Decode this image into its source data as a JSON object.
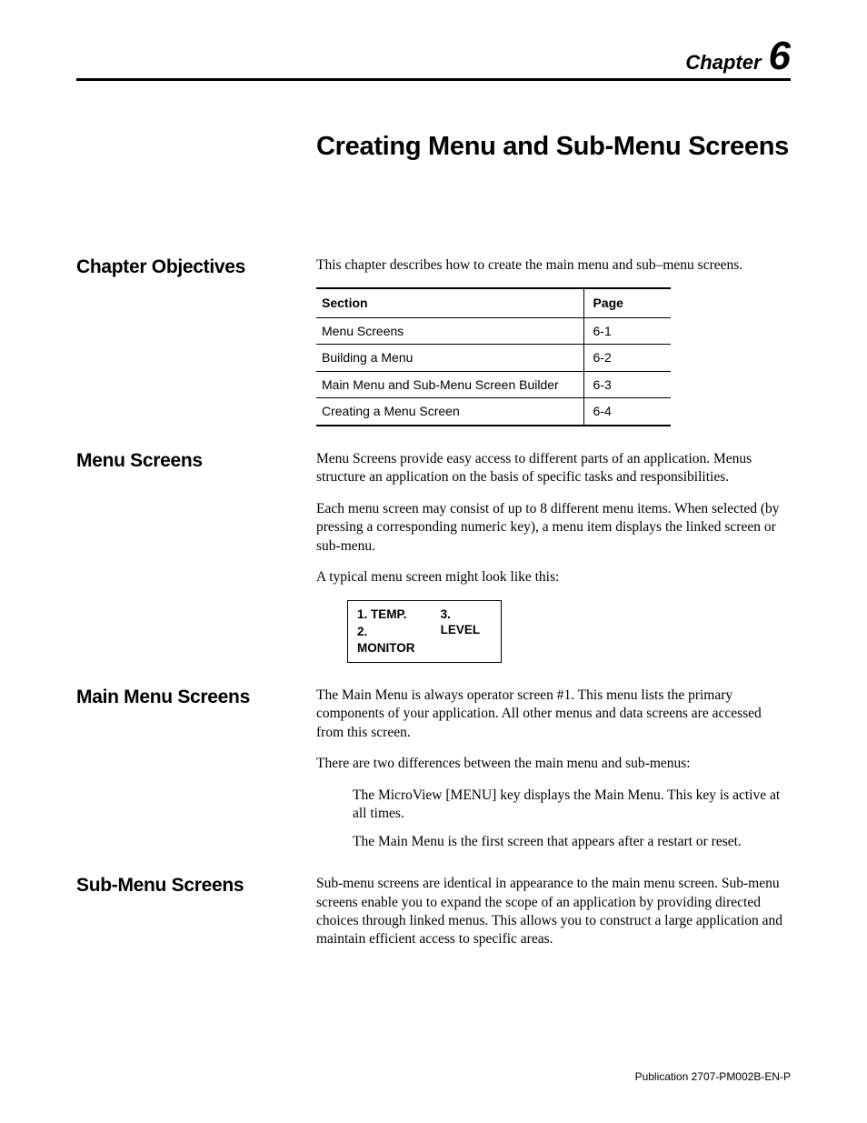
{
  "chapter": {
    "word": "Chapter",
    "num": "6",
    "title": "Creating Menu and Sub-Menu Screens"
  },
  "sections": {
    "objectives": {
      "heading": "Chapter Objectives",
      "intro": "This chapter describes how to create the main menu and sub–menu screens.",
      "table": {
        "head_section": "Section",
        "head_page": "Page",
        "rows": [
          {
            "section": "Menu Screens",
            "page": "6-1"
          },
          {
            "section": "Building a Menu",
            "page": "6-2"
          },
          {
            "section": "Main Menu and Sub-Menu Screen Builder",
            "page": "6-3"
          },
          {
            "section": "Creating a Menu Screen",
            "page": "6-4"
          }
        ]
      }
    },
    "menu_screens": {
      "heading": "Menu Screens",
      "p1": "Menu Screens provide easy access to different parts of an application. Menus structure an application on the basis of specific tasks and responsibilities.",
      "p2": "Each menu screen may consist of up to 8 different menu items. When selected (by pressing a corresponding numeric key), a menu item displays the linked screen or sub-menu.",
      "p3": "A typical menu screen might look like this:",
      "example": {
        "c1a": "1. TEMP.",
        "c1b": "2. MONITOR",
        "c2a": "3. LEVEL"
      }
    },
    "main_menu": {
      "heading": "Main Menu Screens",
      "p1": "The Main Menu is always operator screen #1.  This menu lists the primary components of your application.  All other menus and data screens are accessed from this screen.",
      "p2": "There are two differences between the main menu and sub-menus:",
      "b1": "The MicroView [MENU] key displays the Main Menu.  This key is active at all times.",
      "b2": "The Main Menu is the first screen that appears after a restart or reset."
    },
    "sub_menu": {
      "heading": "Sub-Menu Screens",
      "p1": "Sub-menu screens are identical in appearance to the main menu screen.  Sub-menu screens enable you to expand the scope of an application by providing directed choices through linked menus.  This allows you to construct a large application and maintain efficient access to specific areas."
    }
  },
  "footer": "Publication 2707-PM002B-EN-P"
}
